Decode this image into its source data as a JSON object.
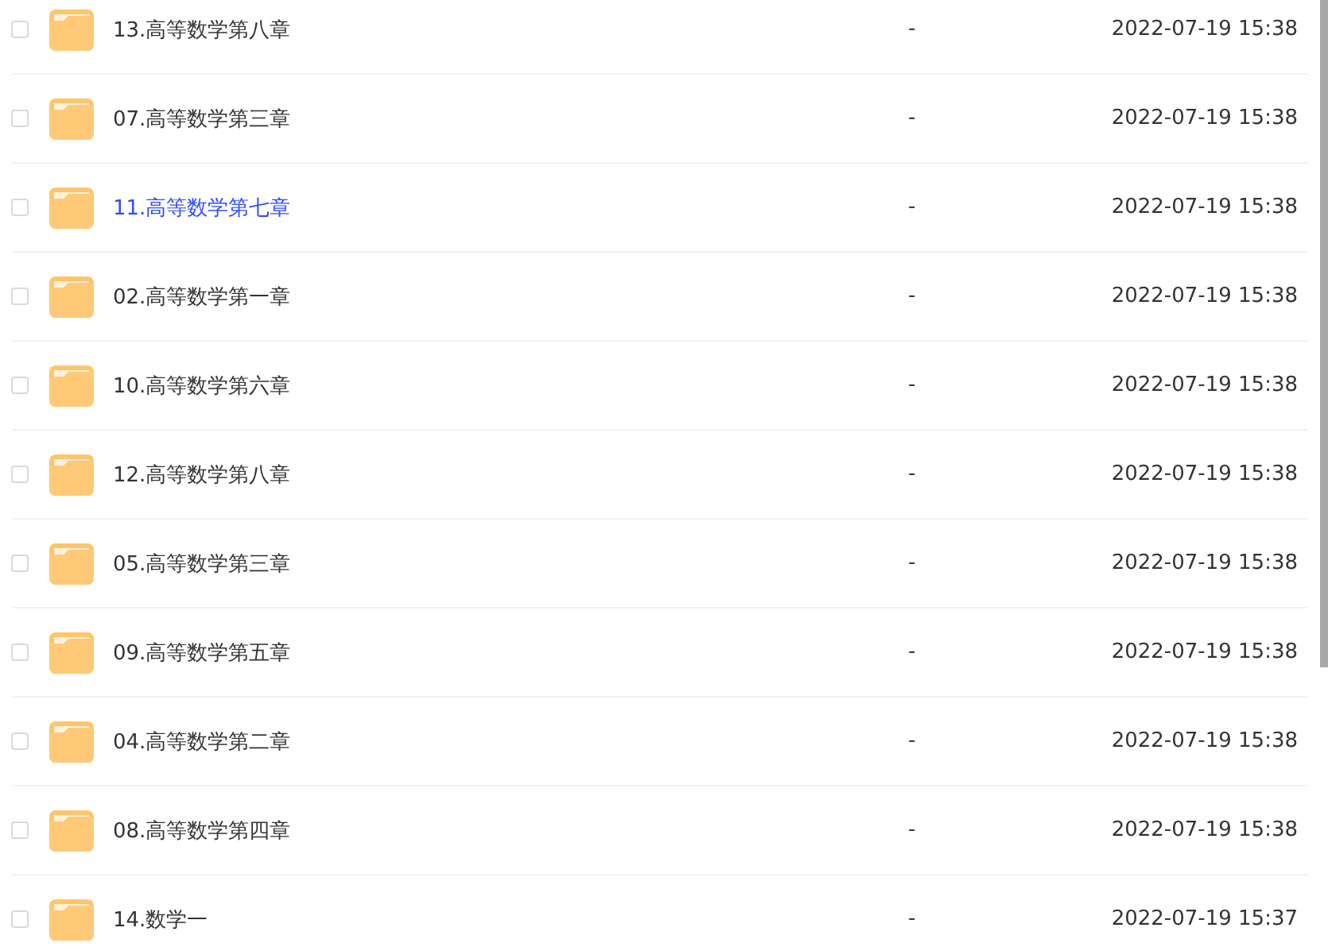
{
  "rows": [
    {
      "name": "13.高等数学第八章",
      "size": "-",
      "modified": "2022-07-19 15:38",
      "checked": false,
      "hovered": false
    },
    {
      "name": "07.高等数学第三章",
      "size": "-",
      "modified": "2022-07-19 15:38",
      "checked": false,
      "hovered": false
    },
    {
      "name": "11.高等数学第七章",
      "size": "-",
      "modified": "2022-07-19 15:38",
      "checked": false,
      "hovered": true
    },
    {
      "name": "02.高等数学第一章",
      "size": "-",
      "modified": "2022-07-19 15:38",
      "checked": false,
      "hovered": false
    },
    {
      "name": "10.高等数学第六章",
      "size": "-",
      "modified": "2022-07-19 15:38",
      "checked": false,
      "hovered": false
    },
    {
      "name": "12.高等数学第八章",
      "size": "-",
      "modified": "2022-07-19 15:38",
      "checked": false,
      "hovered": false
    },
    {
      "name": "05.高等数学第三章",
      "size": "-",
      "modified": "2022-07-19 15:38",
      "checked": false,
      "hovered": false
    },
    {
      "name": "09.高等数学第五章",
      "size": "-",
      "modified": "2022-07-19 15:38",
      "checked": false,
      "hovered": false
    },
    {
      "name": "04.高等数学第二章",
      "size": "-",
      "modified": "2022-07-19 15:38",
      "checked": false,
      "hovered": false
    },
    {
      "name": "08.高等数学第四章",
      "size": "-",
      "modified": "2022-07-19 15:38",
      "checked": false,
      "hovered": false
    },
    {
      "name": "14.数学一",
      "size": "-",
      "modified": "2022-07-19 15:37",
      "checked": false,
      "hovered": false
    }
  ]
}
